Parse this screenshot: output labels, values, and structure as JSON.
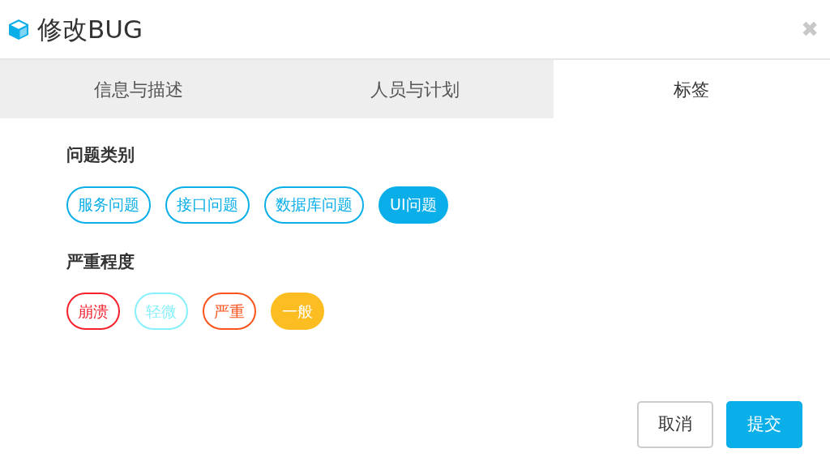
{
  "window": {
    "title": "修改BUG",
    "close": "✖"
  },
  "tabs": [
    {
      "label": "信息与描述",
      "selected": false
    },
    {
      "label": "人员与计划",
      "selected": false
    },
    {
      "label": "标签",
      "selected": true
    }
  ],
  "groups": [
    {
      "title": "问题类别",
      "tags": [
        {
          "label": "服务问题",
          "color": "#0aaee9",
          "selected": false
        },
        {
          "label": "接口问题",
          "color": "#0aaee9",
          "selected": false
        },
        {
          "label": "数据库问题",
          "color": "#0aaee9",
          "selected": false
        },
        {
          "label": "UI问题",
          "color": "#0aaee9",
          "selected": true
        }
      ]
    },
    {
      "title": "严重程度",
      "tags": [
        {
          "label": "崩溃",
          "color": "#f5222d",
          "selected": false
        },
        {
          "label": "轻微",
          "color": "#87f0fb",
          "selected": false
        },
        {
          "label": "严重",
          "color": "#fa541c",
          "selected": false
        },
        {
          "label": "一般",
          "color": "#fcbd22",
          "selected": true
        }
      ]
    }
  ],
  "buttons": [
    {
      "label": "取消",
      "kind": "secondary"
    },
    {
      "label": "提交",
      "kind": "primary"
    }
  ]
}
